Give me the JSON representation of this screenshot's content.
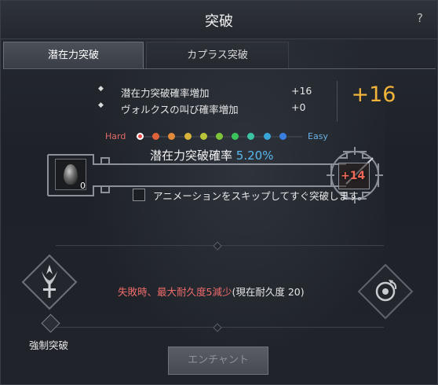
{
  "window": {
    "title": "突破",
    "help_label": "?"
  },
  "tabs": [
    {
      "label": "潜在力突破",
      "active": true
    },
    {
      "label": "カプラス突破",
      "active": false
    }
  ],
  "bonuses": [
    {
      "bullet": "◆",
      "label": "潜在力突破確率増加",
      "value": "+16"
    },
    {
      "bullet": "◆",
      "label": "ヴォルクスの叫び確率増加",
      "value": "+0"
    }
  ],
  "total_bonus": "+16",
  "difficulty": {
    "hard_label": "Hard",
    "easy_label": "Easy",
    "dot_colors": [
      "#e84a4a",
      "#e0623a",
      "#e08a3a",
      "#d8b23a",
      "#b8c43a",
      "#7ec43a",
      "#3ac45a",
      "#3ac4a2",
      "#3aa6d8",
      "#3a7ee0"
    ]
  },
  "rate": {
    "label": "潜在力突破確率",
    "value": "5.20%"
  },
  "material": {
    "count": "0",
    "icon": "black-stone-icon"
  },
  "target": {
    "level": "+14",
    "icon": "sword-icon"
  },
  "skip_animation": {
    "label": "アニメーションをスキップしてすぐ突破します。",
    "checked": false
  },
  "warning": {
    "red_text": "失敗時、最大耐久度5減少",
    "current_text": "(現在耐久度 20)"
  },
  "force_enhance": {
    "label": "強制突破",
    "icon": "forced-enhance-emblem-icon"
  },
  "right_emblem": {
    "icon": "cron-stone-emblem-icon"
  },
  "enchant_button": {
    "label": "エンチャント"
  },
  "colors": {
    "accent_gold": "#f2b33a",
    "rate_blue": "#58b8ee",
    "hard_red": "#e36a6a",
    "easy_blue": "#6ab0e8",
    "warning_red": "#ee6b6b",
    "level_red": "#f06a5a"
  }
}
